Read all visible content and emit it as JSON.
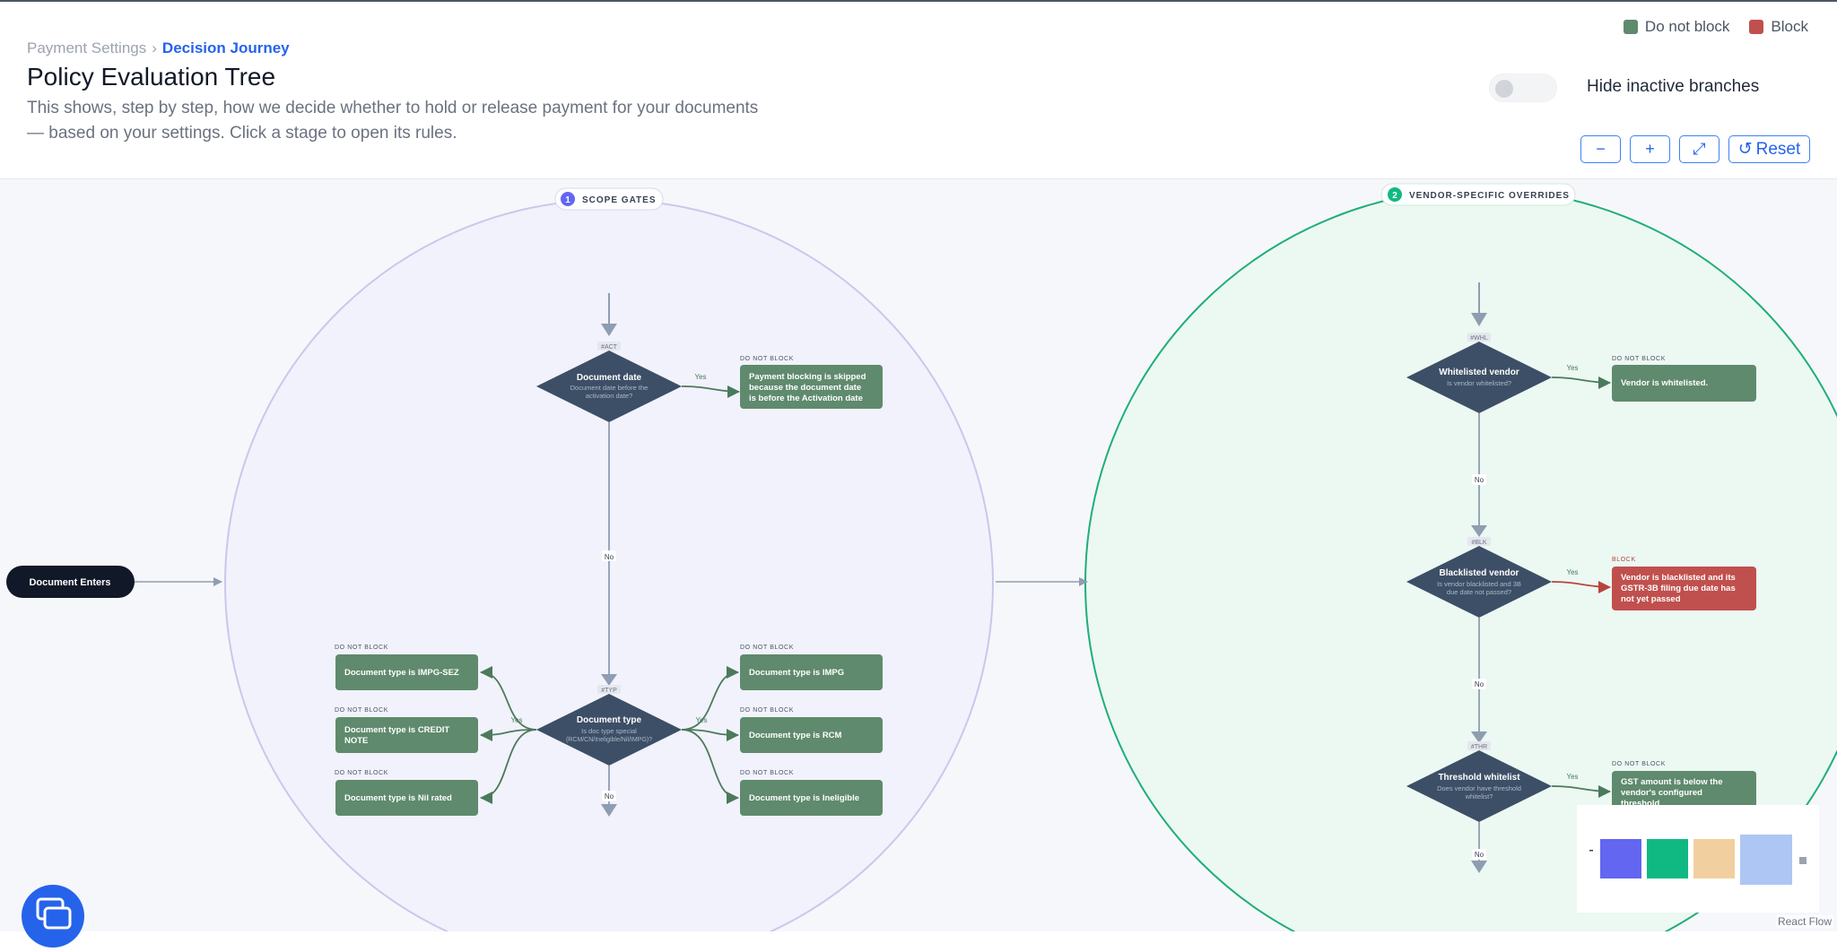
{
  "breadcrumb": {
    "parent": "Payment Settings",
    "separator": "›",
    "current": "Decision Journey"
  },
  "page": {
    "title": "Policy Evaluation Tree",
    "description": "This shows, step by step, how we decide whether to hold or release payment for your documents — based on your settings. Click a stage to open its rules."
  },
  "legend": [
    {
      "label": "Do not block",
      "color": "#5f8a6d"
    },
    {
      "label": "Block",
      "color": "#c0504d"
    }
  ],
  "toggle": {
    "label": "Hide inactive branches",
    "on": false
  },
  "zoom": {
    "zoom_out": "−",
    "zoom_in": "+",
    "fit": "⤢",
    "reset_icon": "↺",
    "reset": "Reset"
  },
  "flow": {
    "start": "Document Enters",
    "stage1": {
      "number": "1",
      "title": "SCOPE GATES"
    },
    "stage2": {
      "number": "2",
      "title": "VENDOR-SPECIFIC OVERRIDES"
    },
    "yes": "Yes",
    "no": "No",
    "do_not_block": "DO NOT BLOCK",
    "block": "BLOCK",
    "decisions": {
      "act": {
        "code": "#ACT",
        "title": "Document date",
        "sub1": "Document date before the",
        "sub2": "activation date?"
      },
      "typ": {
        "code": "#TYP",
        "title": "Document type",
        "sub1": "Is doc type special",
        "sub2": "(RCM/CN/Ineligible/Nil/IMPG)?"
      },
      "whl": {
        "code": "#WHL",
        "title": "Whitelisted vendor",
        "sub1": "Is vendor whitelisted?",
        "sub2": ""
      },
      "blk": {
        "code": "#BLK",
        "title": "Blacklisted vendor",
        "sub1": "Is vendor blacklisted and 3B",
        "sub2": "due date not passed?"
      },
      "thr": {
        "code": "#THR",
        "title": "Threshold whitelist",
        "sub1": "Does vendor have threshold",
        "sub2": "whitelist?"
      }
    },
    "outcomes": {
      "act": {
        "l1": "Payment blocking is skipped",
        "l2": "because the document date",
        "l3": "is before the Activation date"
      },
      "impg_sez": {
        "l1": "Document type is IMPG-SEZ"
      },
      "credit_note": {
        "l1": "Document type is CREDIT",
        "l2": "NOTE"
      },
      "nil_rated": {
        "l1": "Document type is Nil rated"
      },
      "impg": {
        "l1": "Document type is IMPG"
      },
      "rcm": {
        "l1": "Document type is RCM"
      },
      "ineligible": {
        "l1": "Document type is Ineligible"
      },
      "whl": {
        "l1": "Vendor is whitelisted."
      },
      "blk": {
        "l1": "Vendor is blacklisted and its",
        "l2": "GSTR-3B filing due date has",
        "l3": "not yet passed"
      },
      "thr": {
        "l1": "GST amount is below the",
        "l2": "vendor's configured",
        "l3": "threshold"
      }
    }
  },
  "colors": {
    "decision": "#3d4f66",
    "do_not_block": "#5f8a6d",
    "block": "#c0504d",
    "stage1_fill": "#f1f2fb",
    "stage1_border": "#c7c9ec",
    "stage2_fill": "#ecf8f2",
    "stage2_border": "#1fae7a",
    "minimap": [
      "#6366f1",
      "#10b981",
      "#f2cf9f",
      "#aec6f4"
    ]
  },
  "attribution": "React Flow"
}
